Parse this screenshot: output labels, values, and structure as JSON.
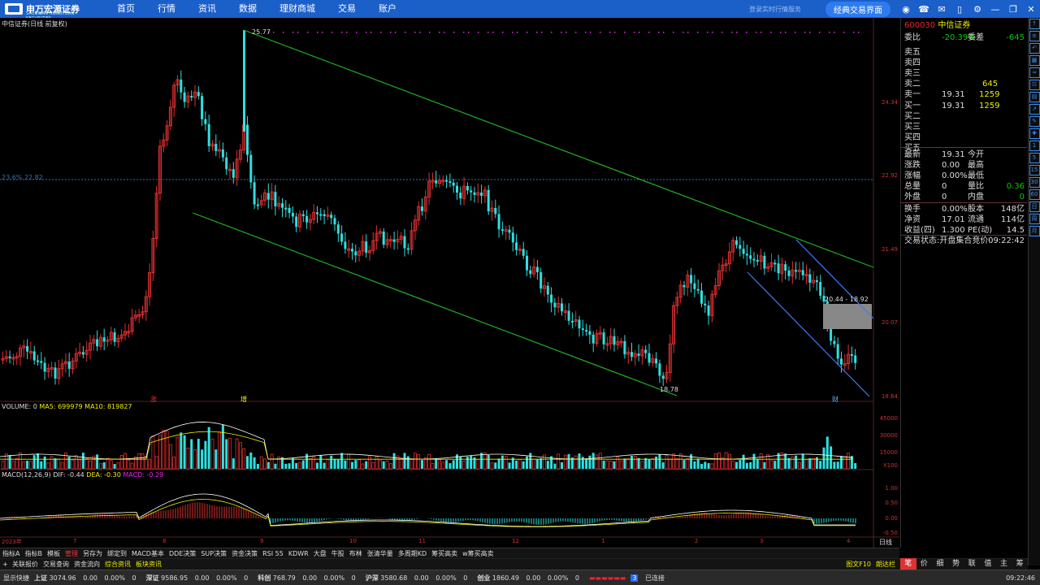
{
  "brand": {
    "name": "申万宏源证券",
    "sub": "SHENWAN HONGYUAN SECURITIES"
  },
  "menu": [
    "首页",
    "行情",
    "资讯",
    "数据",
    "理财商城",
    "交易",
    "账户"
  ],
  "topright": {
    "login": "登录实时行情服务",
    "classic": "经典交易界面",
    "icons": [
      "security-icon",
      "headset-icon",
      "message-icon",
      "phone-icon",
      "settings-icon",
      "minimize-icon",
      "restore-icon",
      "close-icon"
    ]
  },
  "chart_title": "中信证券(日线 前复权)",
  "annotations": {
    "high": "25.77",
    "low": "18.78",
    "fib": "23.6% 22.82",
    "range": "20.44 - 18.92",
    "marks": [
      "涨",
      "增",
      "财"
    ]
  },
  "price_axis": [
    "24.34",
    "22.92",
    "21.49",
    "20.07",
    "18.64"
  ],
  "volume_header": {
    "label": "VOLUME: 0",
    "ma5": "MA5: 699979",
    "ma10": "MA10: 819827"
  },
  "volume_axis": [
    "45000",
    "30000",
    "15000",
    "X100"
  ],
  "macd_header": {
    "label": "MACD(12,26,9)",
    "dif": "DIF: -0.44",
    "dea": "DEA: -0.30",
    "macd": "MACD: -0.29"
  },
  "macd_axis": [
    "1.00",
    "0.50",
    "0.00",
    "-0.50"
  ],
  "date_axis": [
    "2023年",
    "7",
    "8",
    "9",
    "10",
    "11",
    "12",
    "1",
    "2",
    "3",
    "4"
  ],
  "date_axis_right": "日线",
  "quote": {
    "code": "600030",
    "name": "中信证券",
    "ratio_label": "委比",
    "ratio": "-20.39%",
    "diff_label": "委差",
    "diff": "-645",
    "ask_labels": [
      "卖五",
      "卖四",
      "卖三",
      "卖二",
      "卖一"
    ],
    "ask2_vol": "645",
    "ask1_price": "19.31",
    "ask1_vol": "1259",
    "bid_labels": [
      "买一",
      "买二",
      "买三",
      "买四",
      "买五"
    ],
    "bid1_price": "19.31",
    "bid1_vol": "1259",
    "stats": [
      [
        "最新",
        "19.31",
        "今开",
        ""
      ],
      [
        "涨跌",
        "0.00",
        "最高",
        ""
      ],
      [
        "涨幅",
        "0.00%",
        "最低",
        ""
      ],
      [
        "总量",
        "0",
        "量比",
        "0.36"
      ],
      [
        "外盘",
        "0",
        "内盘",
        "0"
      ]
    ],
    "stats2": [
      [
        "换手",
        "0.00%",
        "股本",
        "148亿"
      ],
      [
        "净资",
        "17.01",
        "流通",
        "114亿"
      ],
      [
        "收益(四)",
        "1.300",
        "PE(动)",
        "14.5"
      ]
    ],
    "trade_state_label": "交易状态:",
    "trade_state": "开盘集合竞价",
    "trade_time": "09:22:42"
  },
  "indicator_tabs": [
    "指标A",
    "指标B",
    "模板",
    "管理",
    "另存为",
    "绑定到",
    "MACD基本",
    "DDE决策",
    "SUP决策",
    "资金决策",
    "RSI 55",
    "KDWR",
    "大盘",
    "牛股",
    "布林",
    "张清华量",
    "多周期KD",
    "筹买高卖",
    "w筹买高卖"
  ],
  "bottom_tabs": [
    "关联报价",
    "交易查询",
    "资金流向",
    "综合资讯",
    "板块资讯"
  ],
  "bottom_right": [
    "图文F10",
    "朗达栏"
  ],
  "right_tabs": [
    "笔",
    "价",
    "细",
    "势",
    "联",
    "值",
    "主",
    "筹"
  ],
  "status": {
    "quick": "显示快捷",
    "sh": {
      "label": "上证",
      "value": "3074.96",
      "chg": "0.00",
      "pct": "0.00%",
      "vol": "0"
    },
    "sz": {
      "label": "深证",
      "value": "9586.95",
      "chg": "0.00",
      "pct": "0.00%",
      "vol": "0"
    },
    "kc": {
      "label": "科创",
      "value": "768.79",
      "chg": "0.00",
      "pct": "0.00%",
      "vol": "0"
    },
    "hs": {
      "label": "沪深",
      "value": "3580.68",
      "chg": "0.00",
      "pct": "0.00%",
      "vol": "0"
    },
    "cy": {
      "label": "创业",
      "value": "1860.49",
      "chg": "0.00",
      "pct": "0.00%",
      "vol": "0"
    },
    "conn_num": "3",
    "conn": "已连接",
    "time": "09:22:46"
  },
  "colors": {
    "up": "#e03030",
    "down": "#2ee0e0",
    "channel": "#20b020",
    "channel2": "#3a7cff",
    "topbar": "#1b5fc9"
  }
}
